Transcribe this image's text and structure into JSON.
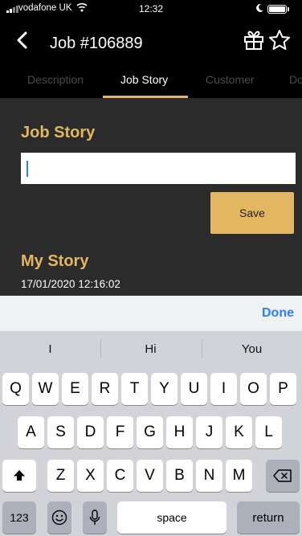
{
  "status_bar": {
    "carrier": "vodafone UK",
    "time": "12:32"
  },
  "header": {
    "title": "Job #106889"
  },
  "tabs": [
    {
      "label": "Description",
      "active": false
    },
    {
      "label": "Job Story",
      "active": true
    },
    {
      "label": "Customer",
      "active": false
    },
    {
      "label": "Do",
      "active": false
    }
  ],
  "job_story": {
    "heading": "Job Story",
    "input_value": "",
    "save_label": "Save"
  },
  "my_story": {
    "heading": "My Story",
    "entries": [
      {
        "date": "17/01/2020 12:16:02"
      }
    ]
  },
  "keyboard": {
    "done_label": "Done",
    "predictions": [
      "I",
      "Hi",
      "You"
    ],
    "row1": [
      "Q",
      "W",
      "E",
      "R",
      "T",
      "Y",
      "U",
      "I",
      "O",
      "P"
    ],
    "row2": [
      "A",
      "S",
      "D",
      "F",
      "G",
      "H",
      "J",
      "K",
      "L"
    ],
    "row3": [
      "Z",
      "X",
      "C",
      "V",
      "B",
      "N",
      "M"
    ],
    "numbers_label": "123",
    "space_label": "space",
    "return_label": "return"
  },
  "colors": {
    "accent": "#e3b662",
    "content_background": "#2b2b2b",
    "header_background": "#000000",
    "ios_blue": "#2d7ff9"
  },
  "icons": {
    "back": "chevron-left-icon",
    "gift": "gift-icon",
    "favourite": "star-icon",
    "shift": "shift-icon",
    "delete": "backspace-icon",
    "emoji": "emoji-icon",
    "dictation": "microphone-icon"
  }
}
